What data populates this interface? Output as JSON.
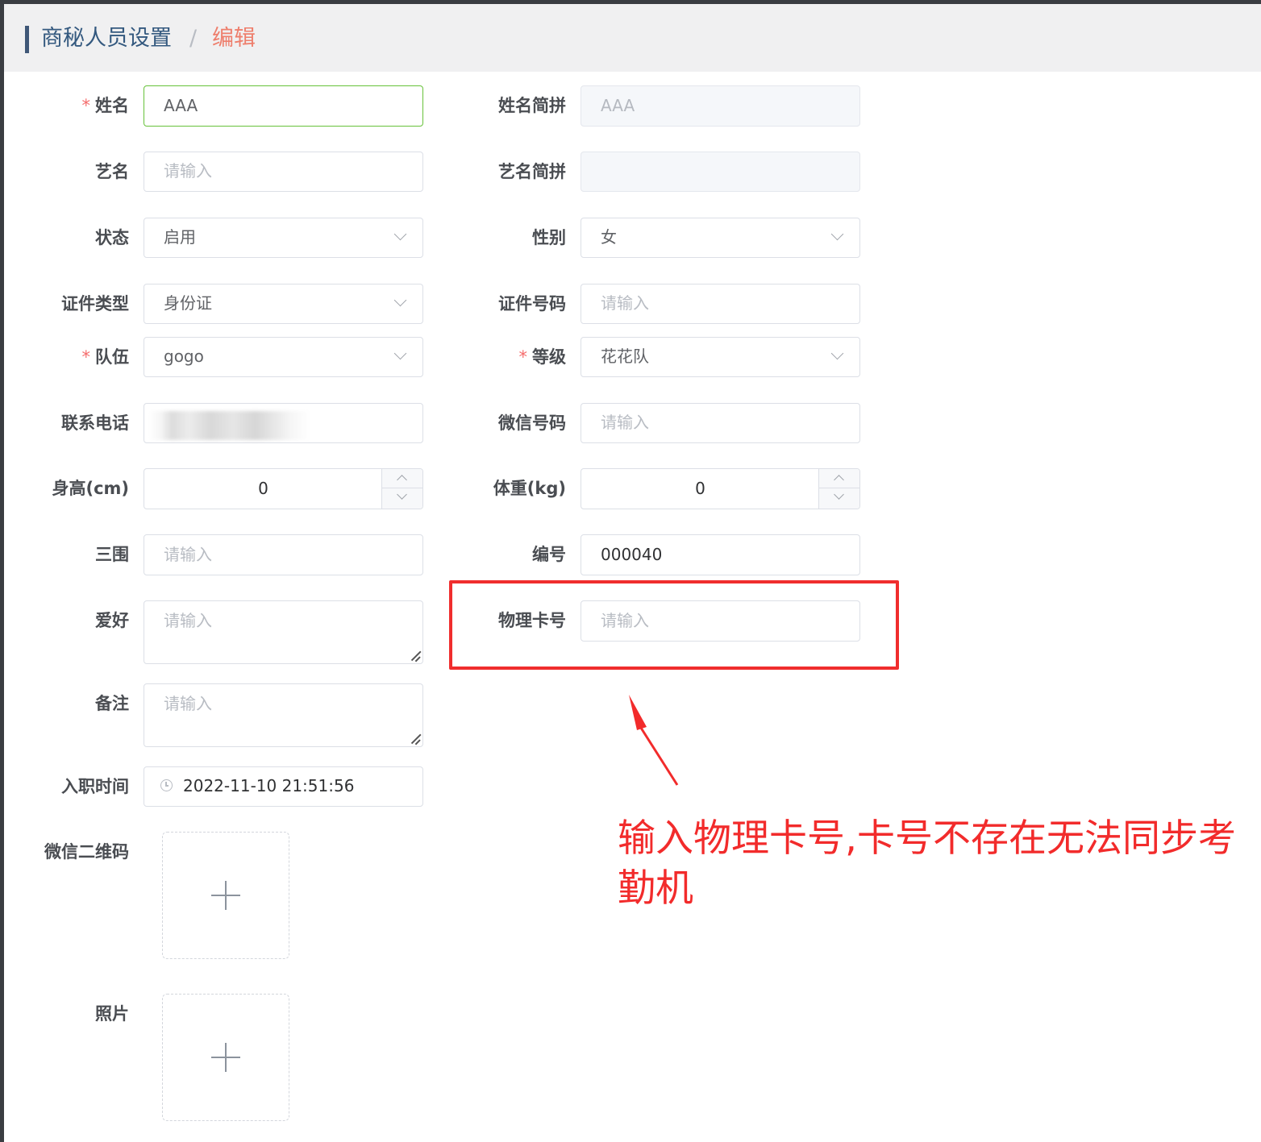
{
  "breadcrumb": {
    "parent": "商秘人员设置",
    "separator": "/",
    "current": "编辑"
  },
  "form": {
    "name": {
      "label": "姓名",
      "required": "*",
      "value": "AAA"
    },
    "name_pinyin": {
      "label": "姓名简拼",
      "value": "AAA"
    },
    "stage_name": {
      "label": "艺名",
      "placeholder": "请输入"
    },
    "stage_pinyin": {
      "label": "艺名简拼",
      "value": ""
    },
    "status": {
      "label": "状态",
      "value": "启用"
    },
    "gender": {
      "label": "性别",
      "value": "女"
    },
    "id_type": {
      "label": "证件类型",
      "value": "身份证"
    },
    "id_number": {
      "label": "证件号码",
      "placeholder": "请输入"
    },
    "team": {
      "label": "队伍",
      "required": "*",
      "value": "gogo"
    },
    "level": {
      "label": "等级",
      "required": "*",
      "value": "花花队"
    },
    "phone": {
      "label": "联系电话",
      "value": ""
    },
    "wechat_id": {
      "label": "微信号码",
      "placeholder": "请输入"
    },
    "height": {
      "label": "身高(cm)",
      "value": "0"
    },
    "weight": {
      "label": "体重(kg)",
      "value": "0"
    },
    "measurements": {
      "label": "三围",
      "placeholder": "请输入"
    },
    "code": {
      "label": "编号",
      "value": "000040"
    },
    "hobby": {
      "label": "爱好",
      "placeholder": "请输入"
    },
    "card_no": {
      "label": "物理卡号",
      "placeholder": "请输入"
    },
    "remark": {
      "label": "备注",
      "placeholder": "请输入"
    },
    "hire_time": {
      "label": "入职时间",
      "value": "2022-11-10 21:51:56"
    },
    "wechat_qr": {
      "label": "微信二维码"
    },
    "photo": {
      "label": "照片"
    }
  },
  "annotation": {
    "text": "输入物理卡号,卡号不存在无法同步考勤机",
    "color": "#f22b2b"
  },
  "icons": [
    "chevron-down-icon",
    "caret-up-icon",
    "caret-down-icon",
    "clock-icon",
    "plus-icon",
    "resize-grip-icon"
  ]
}
